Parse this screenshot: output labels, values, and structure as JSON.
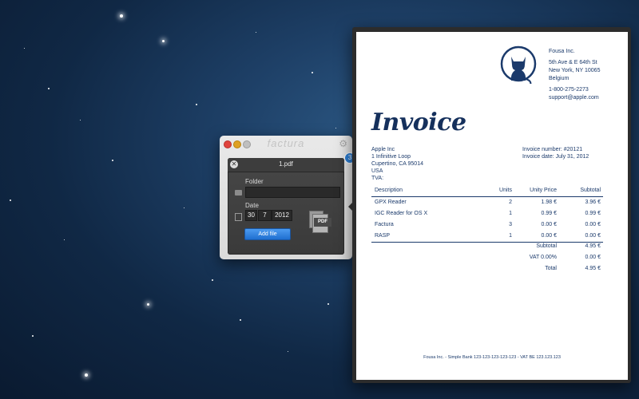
{
  "app": {
    "title": "factura",
    "badge_count": "3",
    "panel": {
      "file_name": "1.pdf",
      "folder_label": "Folder",
      "folder_value": "",
      "date_label": "Date",
      "date_day": "30",
      "date_month": "7",
      "date_year": "2012",
      "add_button": "Add file",
      "pdf_icon_label": "PDF"
    }
  },
  "invoice": {
    "company": {
      "name": "Fousa Inc.",
      "address1": "5th Ave & E 64th St",
      "address2": "New York, NY 10065",
      "country": "Belgium",
      "phone": "1-800-275-2273",
      "email": "support@apple.com"
    },
    "title": "Invoice",
    "client": {
      "name": "Apple Inc",
      "address1": "1 Infinitive Loop",
      "address2": "Cupertino, CA 95014",
      "country": "USA",
      "tva": "TVA:"
    },
    "meta": {
      "number": "Invoice number: #20121",
      "date": "Invoice date: July 31, 2012"
    },
    "table": {
      "headers": {
        "description": "Description",
        "units": "Units",
        "price": "Unity Price",
        "subtotal": "Subtotal"
      },
      "rows": [
        {
          "description": "GPX Reader",
          "units": "2",
          "price": "1.98 €",
          "subtotal": "3.96 €"
        },
        {
          "description": "IGC Reader for OS X",
          "units": "1",
          "price": "0.99 €",
          "subtotal": "0.99 €"
        },
        {
          "description": "Factura",
          "units": "3",
          "price": "0.00 €",
          "subtotal": "0.00 €"
        },
        {
          "description": "RASP",
          "units": "1",
          "price": "0.00 €",
          "subtotal": "0.00 €"
        }
      ]
    },
    "totals": {
      "subtotal_label": "Subtotal",
      "subtotal": "4.95 €",
      "vat_label": "VAT 0.00%",
      "vat": "0.00 €",
      "total_label": "Total",
      "total": "4.95 €"
    },
    "footer": "Fousa Inc. - Simple Bank 123-123-123-123-123 - VAT BE 123.123.123"
  },
  "colors": {
    "accent": "#1b3a6b",
    "button": "#2d7fd6"
  },
  "icons": [
    "close-icon",
    "gear-icon",
    "folder-icon",
    "calendar-icon",
    "pdf-icon",
    "cat-logo-icon"
  ]
}
